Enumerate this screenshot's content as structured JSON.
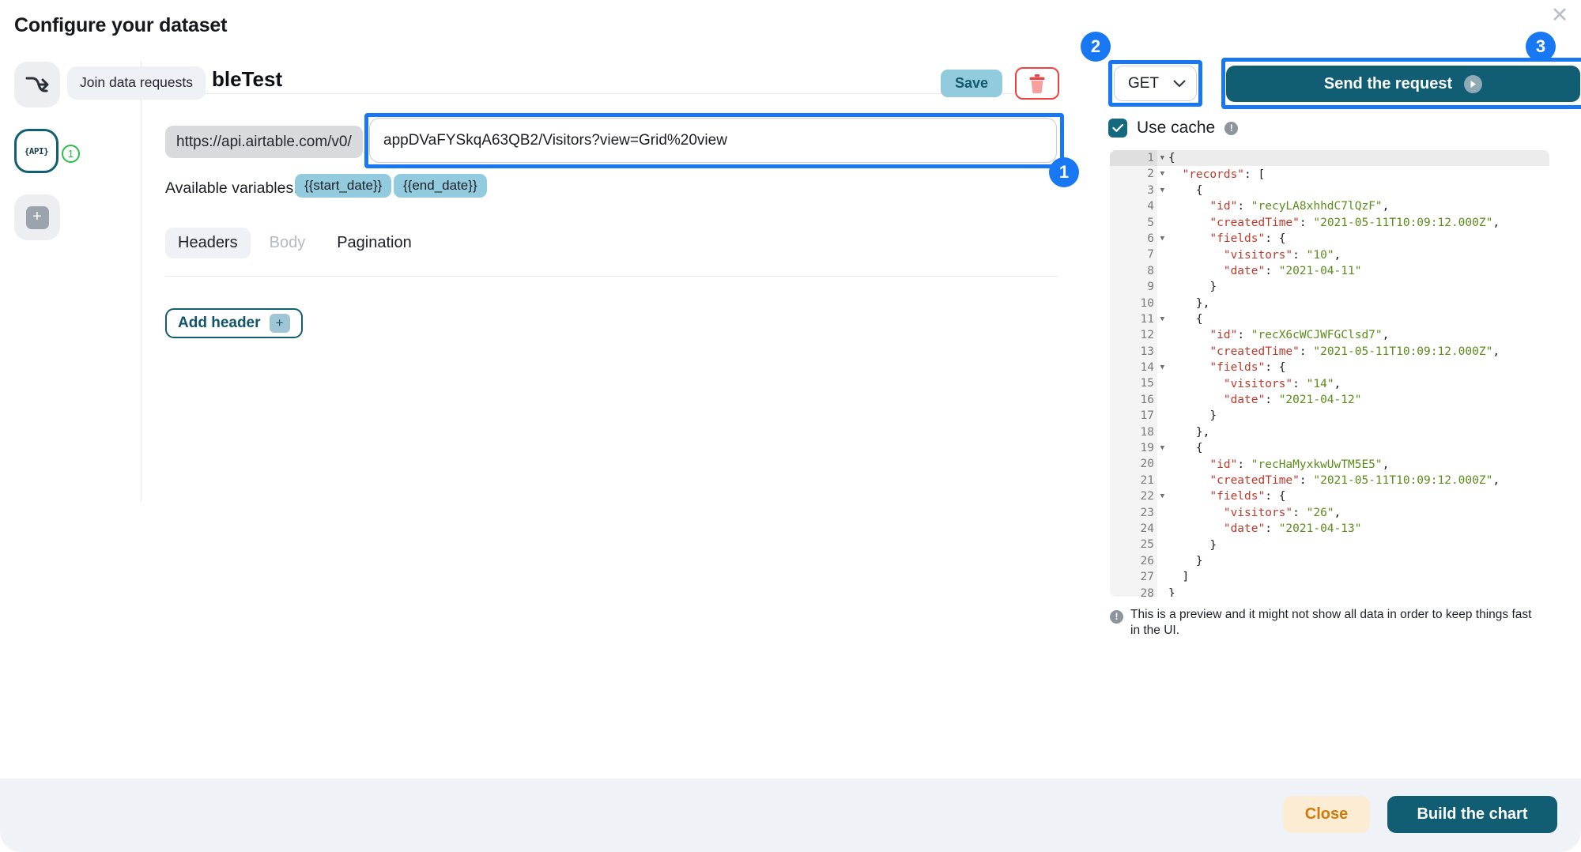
{
  "dialog": {
    "title": "Configure your dataset",
    "close_icon": "close-x-icon"
  },
  "rail": {
    "join_icon": "join-data-requests-icon",
    "api_label": "{API}",
    "api_badge": "1",
    "add_icon": "plus-icon",
    "tooltip": "Join data requests"
  },
  "request": {
    "name": "bleTest",
    "save_label": "Save",
    "delete_icon": "trash-icon",
    "url_prefix": "https://api.airtable.com/v0/",
    "url_value": "appDVaFYSkqA63QB2/Visitors?view=Grid%20view",
    "url_placeholder": "",
    "available_variables_label": "Available variables:",
    "variables": [
      "{{start_date}}",
      "{{end_date}}"
    ],
    "tabs": [
      {
        "label": "Headers",
        "state": "active"
      },
      {
        "label": "Body",
        "state": "disabled"
      },
      {
        "label": "Pagination",
        "state": "normal"
      }
    ],
    "add_header_label": "Add header",
    "add_header_icon": "plus-icon"
  },
  "right": {
    "method": "GET",
    "method_chevron": "chevron-down-icon",
    "send_label": "Send the request",
    "send_icon": "play-icon",
    "use_cache_label": "Use cache",
    "use_cache_checked": true,
    "cache_info_icon": "info-icon",
    "preview_note": "This is a preview and it might not show all data in order to keep things fast in the UI.",
    "preview_info_icon": "info-icon"
  },
  "code": {
    "lines": [
      {
        "n": "1",
        "fold": true,
        "tokens": [
          {
            "t": "{",
            "c": "p"
          }
        ],
        "indent": 0
      },
      {
        "n": "2",
        "fold": true,
        "tokens": [
          {
            "t": "\"records\"",
            "c": "k"
          },
          {
            "t": ": [",
            "c": "p"
          }
        ],
        "indent": 1
      },
      {
        "n": "3",
        "fold": true,
        "tokens": [
          {
            "t": "{",
            "c": "p"
          }
        ],
        "indent": 2
      },
      {
        "n": "4",
        "fold": false,
        "tokens": [
          {
            "t": "\"id\"",
            "c": "k"
          },
          {
            "t": ": ",
            "c": "p"
          },
          {
            "t": "\"recyLA8xhhdC7lQzF\"",
            "c": "s"
          },
          {
            "t": ",",
            "c": "p"
          }
        ],
        "indent": 3
      },
      {
        "n": "5",
        "fold": false,
        "tokens": [
          {
            "t": "\"createdTime\"",
            "c": "k"
          },
          {
            "t": ": ",
            "c": "p"
          },
          {
            "t": "\"2021-05-11T10:09:12.000Z\"",
            "c": "s"
          },
          {
            "t": ",",
            "c": "p"
          }
        ],
        "indent": 3
      },
      {
        "n": "6",
        "fold": true,
        "tokens": [
          {
            "t": "\"fields\"",
            "c": "k"
          },
          {
            "t": ": {",
            "c": "p"
          }
        ],
        "indent": 3
      },
      {
        "n": "7",
        "fold": false,
        "tokens": [
          {
            "t": "\"visitors\"",
            "c": "k"
          },
          {
            "t": ": ",
            "c": "p"
          },
          {
            "t": "\"10\"",
            "c": "s"
          },
          {
            "t": ",",
            "c": "p"
          }
        ],
        "indent": 4
      },
      {
        "n": "8",
        "fold": false,
        "tokens": [
          {
            "t": "\"date\"",
            "c": "k"
          },
          {
            "t": ": ",
            "c": "p"
          },
          {
            "t": "\"2021-04-11\"",
            "c": "s"
          }
        ],
        "indent": 4
      },
      {
        "n": "9",
        "fold": false,
        "tokens": [
          {
            "t": "}",
            "c": "p"
          }
        ],
        "indent": 3
      },
      {
        "n": "10",
        "fold": false,
        "tokens": [
          {
            "t": "},",
            "c": "p"
          }
        ],
        "indent": 2
      },
      {
        "n": "11",
        "fold": true,
        "tokens": [
          {
            "t": "{",
            "c": "p"
          }
        ],
        "indent": 2
      },
      {
        "n": "12",
        "fold": false,
        "tokens": [
          {
            "t": "\"id\"",
            "c": "k"
          },
          {
            "t": ": ",
            "c": "p"
          },
          {
            "t": "\"recX6cWCJWFGClsd7\"",
            "c": "s"
          },
          {
            "t": ",",
            "c": "p"
          }
        ],
        "indent": 3
      },
      {
        "n": "13",
        "fold": false,
        "tokens": [
          {
            "t": "\"createdTime\"",
            "c": "k"
          },
          {
            "t": ": ",
            "c": "p"
          },
          {
            "t": "\"2021-05-11T10:09:12.000Z\"",
            "c": "s"
          },
          {
            "t": ",",
            "c": "p"
          }
        ],
        "indent": 3
      },
      {
        "n": "14",
        "fold": true,
        "tokens": [
          {
            "t": "\"fields\"",
            "c": "k"
          },
          {
            "t": ": {",
            "c": "p"
          }
        ],
        "indent": 3
      },
      {
        "n": "15",
        "fold": false,
        "tokens": [
          {
            "t": "\"visitors\"",
            "c": "k"
          },
          {
            "t": ": ",
            "c": "p"
          },
          {
            "t": "\"14\"",
            "c": "s"
          },
          {
            "t": ",",
            "c": "p"
          }
        ],
        "indent": 4
      },
      {
        "n": "16",
        "fold": false,
        "tokens": [
          {
            "t": "\"date\"",
            "c": "k"
          },
          {
            "t": ": ",
            "c": "p"
          },
          {
            "t": "\"2021-04-12\"",
            "c": "s"
          }
        ],
        "indent": 4
      },
      {
        "n": "17",
        "fold": false,
        "tokens": [
          {
            "t": "}",
            "c": "p"
          }
        ],
        "indent": 3
      },
      {
        "n": "18",
        "fold": false,
        "tokens": [
          {
            "t": "},",
            "c": "p"
          }
        ],
        "indent": 2
      },
      {
        "n": "19",
        "fold": true,
        "tokens": [
          {
            "t": "{",
            "c": "p"
          }
        ],
        "indent": 2
      },
      {
        "n": "20",
        "fold": false,
        "tokens": [
          {
            "t": "\"id\"",
            "c": "k"
          },
          {
            "t": ": ",
            "c": "p"
          },
          {
            "t": "\"recHaMyxkwUwTM5E5\"",
            "c": "s"
          },
          {
            "t": ",",
            "c": "p"
          }
        ],
        "indent": 3
      },
      {
        "n": "21",
        "fold": false,
        "tokens": [
          {
            "t": "\"createdTime\"",
            "c": "k"
          },
          {
            "t": ": ",
            "c": "p"
          },
          {
            "t": "\"2021-05-11T10:09:12.000Z\"",
            "c": "s"
          },
          {
            "t": ",",
            "c": "p"
          }
        ],
        "indent": 3
      },
      {
        "n": "22",
        "fold": true,
        "tokens": [
          {
            "t": "\"fields\"",
            "c": "k"
          },
          {
            "t": ": {",
            "c": "p"
          }
        ],
        "indent": 3
      },
      {
        "n": "23",
        "fold": false,
        "tokens": [
          {
            "t": "\"visitors\"",
            "c": "k"
          },
          {
            "t": ": ",
            "c": "p"
          },
          {
            "t": "\"26\"",
            "c": "s"
          },
          {
            "t": ",",
            "c": "p"
          }
        ],
        "indent": 4
      },
      {
        "n": "24",
        "fold": false,
        "tokens": [
          {
            "t": "\"date\"",
            "c": "k"
          },
          {
            "t": ": ",
            "c": "p"
          },
          {
            "t": "\"2021-04-13\"",
            "c": "s"
          }
        ],
        "indent": 4
      },
      {
        "n": "25",
        "fold": false,
        "tokens": [
          {
            "t": "}",
            "c": "p"
          }
        ],
        "indent": 3
      },
      {
        "n": "26",
        "fold": false,
        "tokens": [
          {
            "t": "}",
            "c": "p"
          }
        ],
        "indent": 2
      },
      {
        "n": "27",
        "fold": false,
        "tokens": [
          {
            "t": "]",
            "c": "p"
          }
        ],
        "indent": 1
      },
      {
        "n": "28",
        "fold": false,
        "tokens": [
          {
            "t": "}",
            "c": "p"
          }
        ],
        "indent": 0
      }
    ]
  },
  "footer": {
    "close_label": "Close",
    "build_label": "Build the chart"
  },
  "annotations": [
    {
      "number": "1",
      "target": "url-input"
    },
    {
      "number": "2",
      "target": "method-select"
    },
    {
      "number": "3",
      "target": "send-request-button"
    }
  ],
  "colors": {
    "accent_teal": "#115e74",
    "annotation_blue": "#1877f2",
    "chip_blue": "#92cbdd",
    "danger_red": "#f0413f",
    "close_orange": "#cd7b0c",
    "badge_green": "#2bbd4b"
  }
}
